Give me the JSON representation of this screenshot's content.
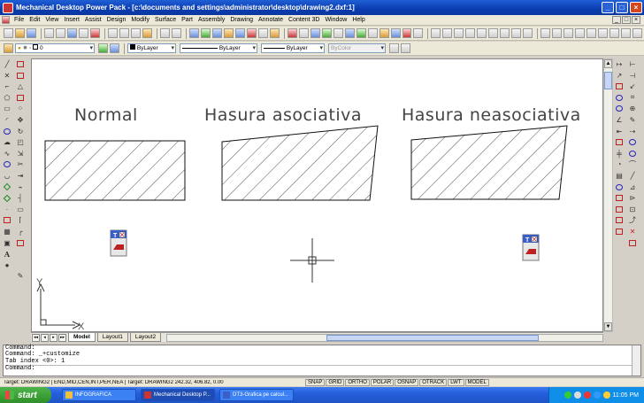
{
  "window": {
    "title": "Mechanical Desktop Power Pack - [c:\\documents and settings\\administrator\\desktop\\drawing2.dxf:1]",
    "btn_min": "_",
    "btn_max": "□",
    "btn_close": "×"
  },
  "menu": {
    "items": [
      "File",
      "Edit",
      "View",
      "Insert",
      "Assist",
      "Design",
      "Modify",
      "Surface",
      "Part",
      "Assembly",
      "Drawing",
      "Annotate",
      "Content 3D",
      "Window",
      "Help"
    ],
    "mdi": [
      "_",
      "□",
      "×"
    ]
  },
  "layers": {
    "current_layer": "0",
    "color": "ByLayer",
    "linetype": "ByLayer",
    "lineweight": "ByLayer",
    "plotstyle": "ByColor"
  },
  "drawing": {
    "labels": [
      "Normal",
      "Hasura asociativa",
      "Hasura neasociativa"
    ],
    "tx_label": "T",
    "ucs": {
      "x": "X",
      "y": "Y"
    }
  },
  "tabs": {
    "nav": [
      "◂◂",
      "◂",
      "▸",
      "▸▸"
    ],
    "items": [
      "Model",
      "Layout1",
      "Layout2"
    ],
    "active": "Model"
  },
  "command": {
    "lines": [
      "Command:",
      "Command: _+customize",
      "Tab index <0>: 1",
      "Command:"
    ]
  },
  "status": {
    "coords": "Target: DRAWING2 | END,MID,CEN,INT,PER,NEA | Target: DRAWING2  242.32, 406.82, 0.00",
    "buttons": [
      "SNAP",
      "GRID",
      "ORTHO",
      "POLAR",
      "OSNAP",
      "OTRACK",
      "LWT",
      "MODEL"
    ]
  },
  "taskbar": {
    "start": "start",
    "tasks": [
      "INFOGRAFICA",
      "Mechanical Desktop P...",
      "DT3-Grafica pe calcul..."
    ],
    "active_task": "Mechanical Desktop P...",
    "time": "11:05 PM"
  }
}
